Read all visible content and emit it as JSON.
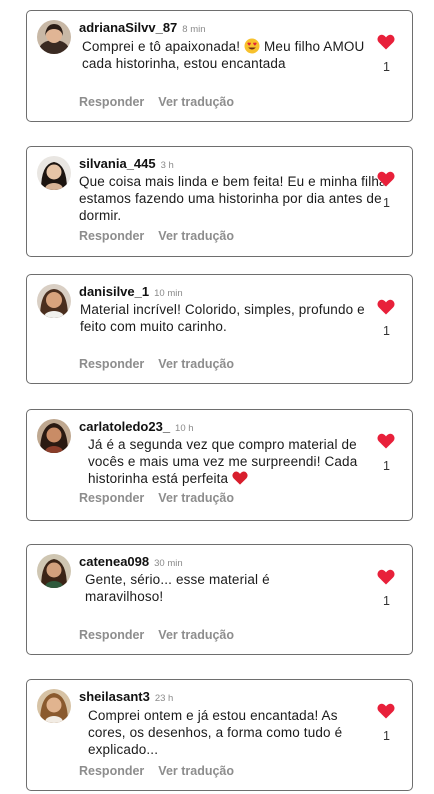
{
  "comments": [
    {
      "username": "adrianaSilvv_87",
      "time": "8 min",
      "text": "Comprei e tô apaixonada! ",
      "text_after": " Meu filho AMOU cada historinha, estou encantada",
      "emoji": "heart-eyes-emoji",
      "likes": "1",
      "reply_label": "Responder",
      "translate_label": "Ver tradução"
    },
    {
      "username": "silvania_445",
      "time": "3 h",
      "text": "Que coisa mais linda e bem feita! Eu e minha filha estamos fazendo uma historinha por dia antes de dormir.",
      "likes": "1",
      "reply_label": "Responder",
      "translate_label": "Ver tradução"
    },
    {
      "username": "danisilve_1",
      "time": "10 min",
      "text": "Material incrível! Colorido, simples, profundo e feito com muito carinho.",
      "likes": "1",
      "reply_label": "Responder",
      "translate_label": "Ver tradução"
    },
    {
      "username": "carlatoledo23_",
      "time": "10 h",
      "text": "Já é a segunda vez que compro material de vocês e mais uma vez me surpreendi! Cada historinha está perfeita ",
      "emoji": "red-heart-emoji",
      "likes": "1",
      "reply_label": "Responder",
      "translate_label": "Ver tradução"
    },
    {
      "username": "catenea098",
      "time": "30 min",
      "text": "Gente, sério... esse material é maravilhoso!",
      "likes": "1",
      "reply_label": "Responder",
      "translate_label": "Ver tradução"
    },
    {
      "username": "sheilasant3",
      "time": "23 h",
      "text": "Comprei ontem e já estou encantada! As cores, os desenhos, a forma como tudo é explicado...",
      "likes": "1",
      "reply_label": "Responder",
      "translate_label": "Ver tradução"
    }
  ],
  "colors": {
    "like_heart": "#e8203a",
    "action_text": "#8d8d8d",
    "border": "#6e6e6e"
  }
}
